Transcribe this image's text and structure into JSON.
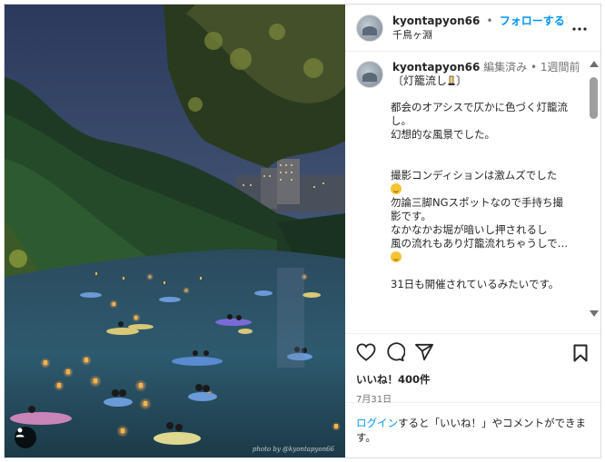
{
  "header": {
    "username": "kyontapyon66",
    "separator": "•",
    "follow_label": "フォローする",
    "location": "千鳥ヶ淵",
    "more_icon": "more-horizontal-icon"
  },
  "comment": {
    "username": "kyontapyon66",
    "edited": "編集済み",
    "separator": "•",
    "time": "1週間前",
    "title_line": "〔灯籠流し",
    "title_end": "〕",
    "caption_part1": "都会のオアシスで仄かに色づく灯籠流し。\n幻想的な風景でした。\n\n\n撮影コンディションは激ムズでした",
    "caption_part2": "\n勿論三脚NGスポットなので手持ち撮影です。\nなかなかお堀が暗いし押されるし\n風の流れもあり灯籠流れちゃうしで…",
    "caption_part3": "\n\n31日も開催されているみたいです。"
  },
  "actions": {
    "like_icon": "heart-icon",
    "comment_icon": "comment-icon",
    "share_icon": "send-icon",
    "save_icon": "bookmark-icon",
    "likes": "いいね！400件",
    "date": "7月31日"
  },
  "login": {
    "link": "ログイン",
    "text": "すると「いいね！」やコメントができます。"
  },
  "photo": {
    "watermark": "photo by @kyontapyon66"
  },
  "colors": {
    "accent": "#0095f6",
    "muted": "#737373",
    "text": "#262626"
  }
}
